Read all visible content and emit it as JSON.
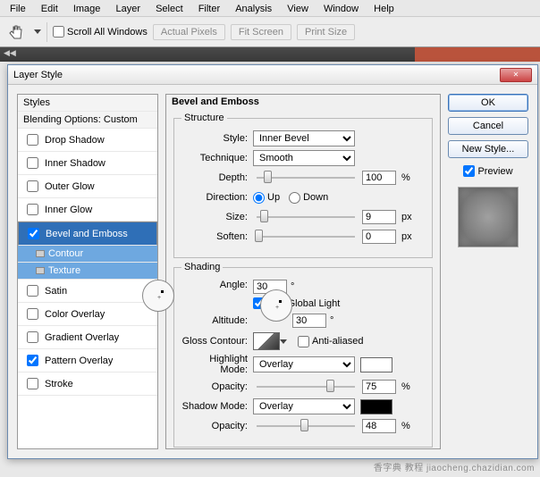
{
  "menu": {
    "file": "File",
    "edit": "Edit",
    "image": "Image",
    "layer": "Layer",
    "select": "Select",
    "filter": "Filter",
    "analysis": "Analysis",
    "view": "View",
    "window": "Window",
    "help": "Help"
  },
  "toolbar": {
    "scroll_label": "Scroll All Windows",
    "actual": "Actual Pixels",
    "fit": "Fit Screen",
    "print": "Print Size"
  },
  "dialog": {
    "title": "Layer Style"
  },
  "styles": {
    "header": "Styles",
    "blending": "Blending Options: Custom",
    "drop": "Drop Shadow",
    "inner_sh": "Inner Shadow",
    "outer_g": "Outer Glow",
    "inner_g": "Inner Glow",
    "bevel": "Bevel and Emboss",
    "contour": "Contour",
    "texture": "Texture",
    "satin": "Satin",
    "color_o": "Color Overlay",
    "grad_o": "Gradient Overlay",
    "patt_o": "Pattern Overlay",
    "stroke": "Stroke"
  },
  "bevel": {
    "title": "Bevel and Emboss",
    "structure": "Structure",
    "style_l": "Style:",
    "style_v": "Inner Bevel",
    "tech_l": "Technique:",
    "tech_v": "Smooth",
    "depth_l": "Depth:",
    "depth_v": "100",
    "depth_u": "%",
    "dir_l": "Direction:",
    "up": "Up",
    "down": "Down",
    "size_l": "Size:",
    "size_v": "9",
    "size_u": "px",
    "soft_l": "Soften:",
    "soft_v": "0",
    "soft_u": "px",
    "shading": "Shading",
    "angle_l": "Angle:",
    "angle_v": "30",
    "deg": "°",
    "global": "Use Global Light",
    "alt_l": "Altitude:",
    "alt_v": "30",
    "gloss_l": "Gloss Contour:",
    "aa": "Anti-aliased",
    "hl_l": "Highlight Mode:",
    "hl_v": "Overlay",
    "hl_color": "#ffffff",
    "op_l": "Opacity:",
    "hl_op": "75",
    "sh_l": "Shadow Mode:",
    "sh_v": "Overlay",
    "sh_color": "#000000",
    "sh_op": "48",
    "pct": "%"
  },
  "buttons": {
    "ok": "OK",
    "cancel": "Cancel",
    "new_style": "New Style...",
    "preview": "Preview"
  },
  "watermark": "香字典 教程 jiaocheng.chazidian.com"
}
